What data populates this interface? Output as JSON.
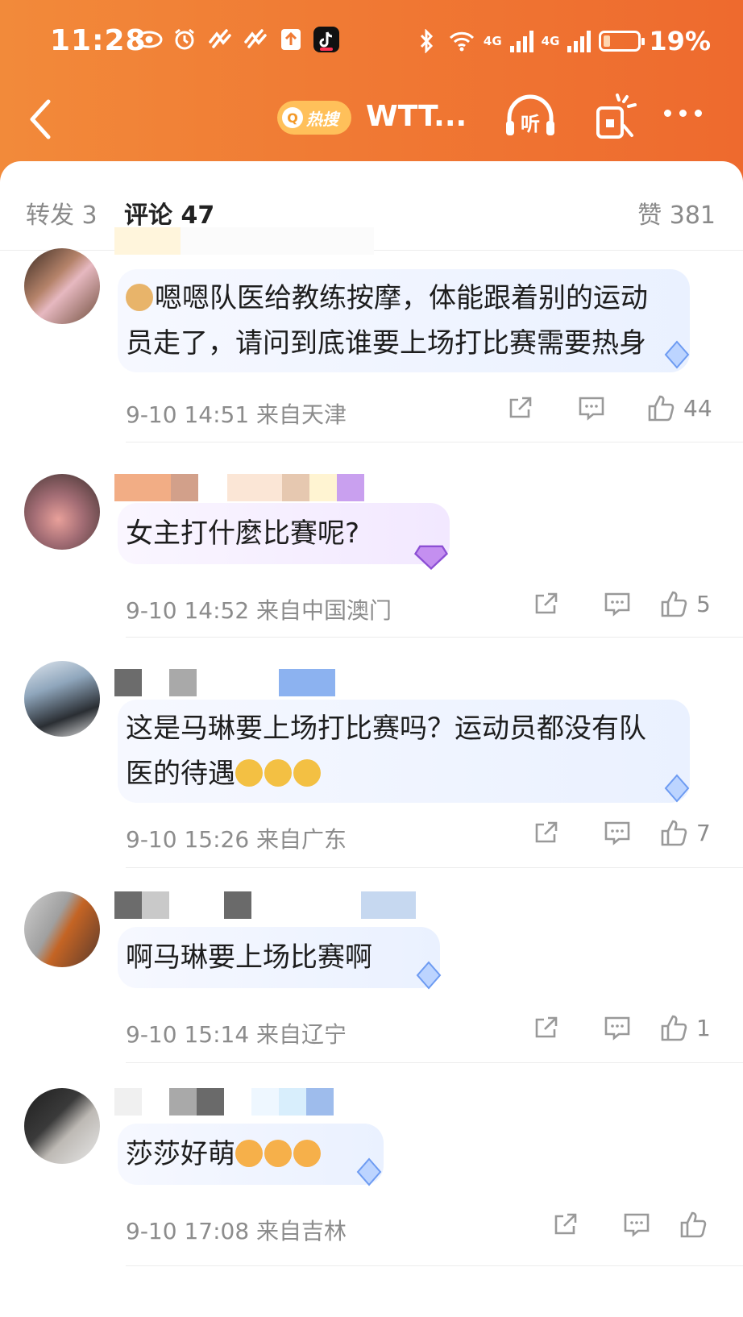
{
  "status_bar": {
    "time": "11:28",
    "network_1": "4G",
    "network_2": "4G",
    "battery_percent": "19%",
    "battery_level": 0.19
  },
  "nav": {
    "hot_search_label": "热搜",
    "title": "WTT...",
    "listen_label": "听"
  },
  "tabs": {
    "repost": "转发 3",
    "comments": "评论 47",
    "likes": "赞 381"
  },
  "comments": [
    {
      "text_line1": "嗯嗯队医给教练按摩，体能跟着别的运动",
      "text_line2": "员走了，请问到底谁要上场打比赛需要热身",
      "time": "9-10 14:51",
      "location": "来自天津",
      "likes": "44",
      "emoji": "dog-emoji"
    },
    {
      "text_line1": "女主打什麼比賽呢?",
      "time": "9-10 14:52",
      "location": "来自中国澳门",
      "likes": "5"
    },
    {
      "text_line1": "这是马琳要上场打比赛吗？运动员都没有队",
      "text_line2": "医的待遇",
      "time": "9-10 15:26",
      "location": "来自广东",
      "likes": "7",
      "emoji": "crying-emoji"
    },
    {
      "text_line1": "啊马琳要上场比赛啊",
      "time": "9-10 15:14",
      "location": "来自辽宁",
      "likes": "1"
    },
    {
      "text_line1": "莎莎好萌",
      "time": "9-10 17:08",
      "location": "来自吉林",
      "likes": "",
      "emoji": "heart-eyes-emoji"
    }
  ]
}
